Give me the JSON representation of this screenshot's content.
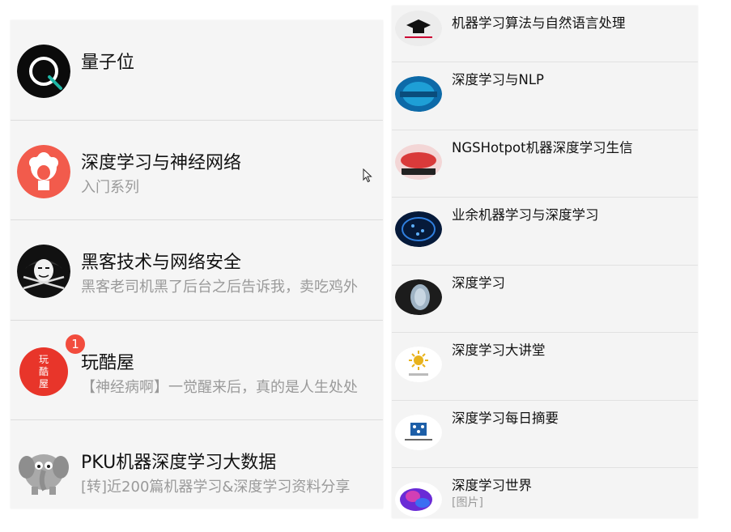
{
  "left_list": [
    {
      "title": "量子位",
      "subtitle": ""
    },
    {
      "title": "深度学习与神经网络",
      "subtitle": "入门系列"
    },
    {
      "title": "黑客技术与网络安全",
      "subtitle": "黑客老司机黑了后台之后告诉我，卖吃鸡外"
    },
    {
      "title": "玩酷屋",
      "subtitle": "【神经病啊】一觉醒来后，真的是人生处处",
      "badge": "1",
      "avatar_text": "玩酷屋"
    },
    {
      "title": "PKU机器深度学习大数据",
      "subtitle": "[转]近200篇机器学习&深度学习资料分享"
    }
  ],
  "right_list": [
    {
      "title": "机器学习算法与自然语言处理",
      "subtitle": ""
    },
    {
      "title": "深度学习与NLP",
      "subtitle": ""
    },
    {
      "title": "NGSHotpot机器深度学习生信",
      "subtitle": ""
    },
    {
      "title": "业余机器学习与深度学习",
      "subtitle": ""
    },
    {
      "title": "深度学习",
      "subtitle": ""
    },
    {
      "title": "深度学习大讲堂",
      "subtitle": ""
    },
    {
      "title": "深度学习每日摘要",
      "subtitle": ""
    },
    {
      "title": "深度学习世界",
      "subtitle": "[图片]"
    }
  ],
  "colors": {
    "badge": "#f24c3d",
    "subtitle": "#9a9a9a",
    "divider": "#dcdcdc"
  },
  "icons": {
    "left": [
      "qbit-logo-icon",
      "afro-avatar-icon",
      "anonymous-mask-icon",
      "wankuwu-seal-icon",
      "elephant-avatar-icon"
    ],
    "right": [
      "graduation-cap-icon",
      "nlp-globe-icon",
      "ngs-hotpot-icon",
      "neural-brain-icon",
      "digital-head-icon",
      "dlclass-sun-icon",
      "network-diagram-icon",
      "purple-brain-icon"
    ]
  }
}
